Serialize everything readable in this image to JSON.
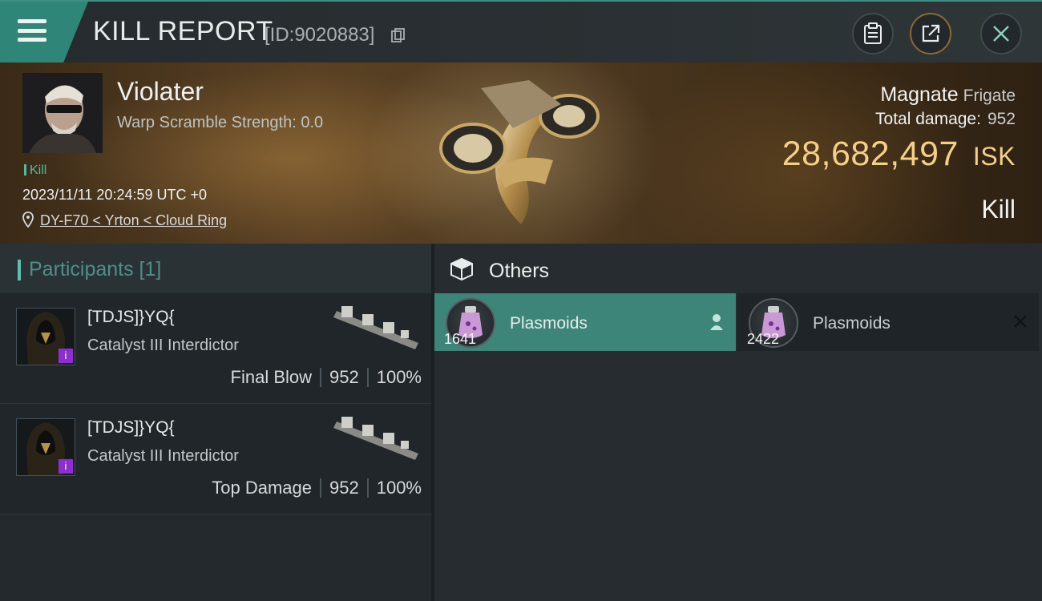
{
  "header": {
    "title": "KILL REPORT",
    "report_id": "[ID:9020883]"
  },
  "victim": {
    "name": "Violater",
    "warp_scramble": "Warp Scramble Strength: 0.0",
    "status_tag": "Kill",
    "datetime": "2023/11/11 20:24:59 UTC +0",
    "location": "DY-F70 < Yrton < Cloud Ring"
  },
  "ship": {
    "name": "Magnate",
    "class": "Frigate",
    "total_damage_label": "Total damage:",
    "total_damage_value": "952",
    "isk_value": "28,682,497",
    "isk_unit": "ISK",
    "result": "Kill"
  },
  "participants": {
    "title": "Participants [1]",
    "items": [
      {
        "name": "[TDJS]}YQ{",
        "ship": "Catalyst III Interdictor",
        "role": "Final Blow",
        "damage": "952",
        "percent": "100%"
      },
      {
        "name": "[TDJS]}YQ{",
        "ship": "Catalyst III Interdictor",
        "role": "Top Damage",
        "damage": "952",
        "percent": "100%"
      }
    ]
  },
  "others": {
    "title": "Others",
    "items": [
      {
        "name": "Plasmoids",
        "quantity": "1641",
        "icon": "person-icon"
      },
      {
        "name": "Plasmoids",
        "quantity": "2422",
        "icon": "close-icon"
      }
    ]
  },
  "colors": {
    "accent_teal": "#3d8579",
    "isk_gold": "#f4cf86",
    "kill_green": "#56b89c",
    "badge_purple": "#8d2fd0"
  }
}
